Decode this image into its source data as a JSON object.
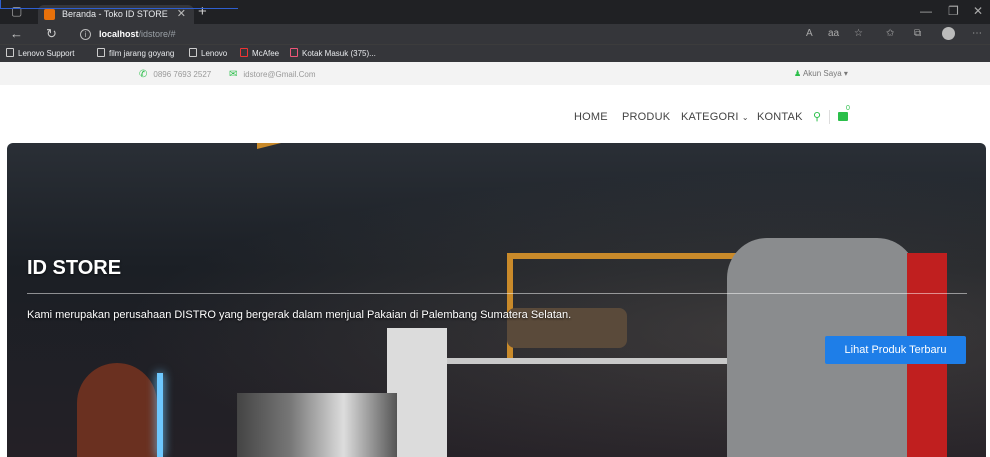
{
  "browser": {
    "tab_title": "Beranda - Toko ID STORE",
    "url_host": "localhost",
    "url_path": "/idstore/#",
    "bookmarks": [
      "Lenovo Support",
      "film jarang goyang",
      "Lenovo",
      "McAfee",
      "Kotak Masuk (375)..."
    ]
  },
  "topbar": {
    "phone": "0896 7693 2527",
    "email": "idstore@Gmail.Com",
    "account": "Akun Saya"
  },
  "nav": {
    "home": "HOME",
    "produk": "PRODUK",
    "kategori": "KATEGORI",
    "kontak": "KONTAK"
  },
  "hero": {
    "title": "ID STORE",
    "text": "Kami merupakan perusahaan DISTRO yang bergerak dalam menjual Pakaian di Palembang Sumatera Selatan.",
    "button": "Lihat Produk Terbaru"
  },
  "colors": {
    "accent": "#2bbf4a",
    "button": "#1e7ee8",
    "chrome": "#202124"
  }
}
